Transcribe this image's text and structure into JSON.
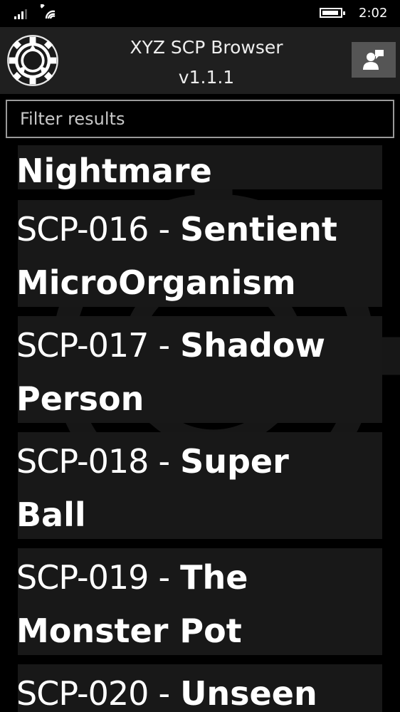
{
  "status": {
    "time": "2:02"
  },
  "header": {
    "title": "XYZ SCP Browser",
    "version": "v1.1.1"
  },
  "search": {
    "placeholder": "Filter results",
    "value": ""
  },
  "items": [
    {
      "number": "",
      "separator": "",
      "name_line1": "",
      "name_line2": "Nightmare"
    },
    {
      "number": "SCP-016",
      "separator": "-",
      "name_line1": "Sentient",
      "name_line2": "MicroOrganism"
    },
    {
      "number": "SCP-017",
      "separator": "-",
      "name_line1": "Shadow",
      "name_line2": "Person"
    },
    {
      "number": "SCP-018",
      "separator": "-",
      "name_line1": "Super",
      "name_line2": "Ball"
    },
    {
      "number": "SCP-019",
      "separator": "-",
      "name_line1": "The",
      "name_line2": "Monster Pot"
    },
    {
      "number": "SCP-020",
      "separator": "-",
      "name_line1": "Unseen",
      "name_line2": ""
    }
  ],
  "icons": {
    "logo": "scp-foundation-logo-icon",
    "profile": "person-chat-icon",
    "signal": "signal-icon",
    "wifi": "wifi-icon",
    "battery": "battery-icon"
  }
}
